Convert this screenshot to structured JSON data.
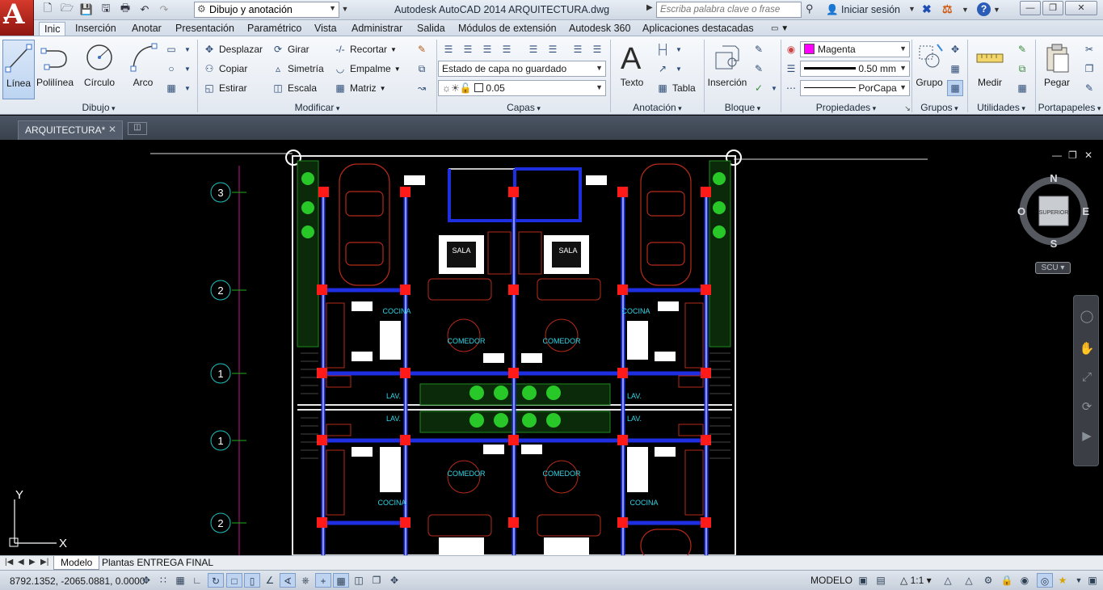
{
  "titlebar": {
    "workspace": "Dibujo y anotación",
    "window_title": "Autodesk AutoCAD 2014    ARQUITECTURA.dwg",
    "search_placeholder": "Escriba palabra clave o frase",
    "login_label": "Iniciar sesión"
  },
  "ribbon_tabs": [
    "Inic",
    "Inserción",
    "Anotar",
    "Presentación",
    "Paramétrico",
    "Vista",
    "Administrar",
    "Salida",
    "Módulos de extensión",
    "Autodesk 360",
    "Aplicaciones destacadas"
  ],
  "ribbon": {
    "dibujo": {
      "title": "Dibujo",
      "linea": "Línea",
      "polilinea": "Polilínea",
      "circulo": "Círculo",
      "arco": "Arco"
    },
    "modificar": {
      "title": "Modificar",
      "desplazar": "Desplazar",
      "girar": "Girar",
      "recortar": "Recortar",
      "copiar": "Copiar",
      "simetria": "Simetría",
      "empalme": "Empalme",
      "estirar": "Estirar",
      "escala": "Escala",
      "matriz": "Matriz"
    },
    "capas": {
      "title": "Capas",
      "estado": "Estado de capa no guardado",
      "layer_value": "0.05"
    },
    "anotacion": {
      "title": "Anotación",
      "texto": "Texto",
      "tabla": "Tabla"
    },
    "bloque": {
      "title": "Bloque",
      "insercion": "Inserción"
    },
    "propiedades": {
      "title": "Propiedades",
      "color": "Magenta",
      "lineweight": "0.50 mm",
      "linetype": "PorCapa"
    },
    "grupos": {
      "title": "Grupos",
      "grupo": "Grupo"
    },
    "utilidades": {
      "title": "Utilidades",
      "medir": "Medir"
    },
    "portapapeles": {
      "title": "Portapapeles",
      "pegar": "Pegar"
    }
  },
  "document_tab": "ARQUITECTURA*",
  "drawing": {
    "grid_bubbles": [
      "3",
      "2",
      "1",
      "1",
      "2"
    ],
    "room_labels": {
      "sala": "SALA",
      "cocina": "COCINA",
      "comedor": "COMEDOR",
      "lav": "LAV."
    }
  },
  "viewcube": {
    "north": "N",
    "south": "S",
    "east": "E",
    "west": "O",
    "face": "SUPERIOR",
    "ucs_menu": "SCU"
  },
  "ucs_icon": {
    "x": "X",
    "y": "Y"
  },
  "layout_tabs": [
    "Modelo",
    "Plantas ENTREGA FINAL"
  ],
  "statusbar": {
    "coords": "8792.1352, -2065.0881, 0.0000",
    "model": "MODELO",
    "anno_scale": "1:1"
  },
  "colors": {
    "accent_red": "#c8281c",
    "magenta": "#ff00ff",
    "canvas": "#000000",
    "wall_blue": "#1d2fe0",
    "column_red": "#ff1a1a"
  }
}
